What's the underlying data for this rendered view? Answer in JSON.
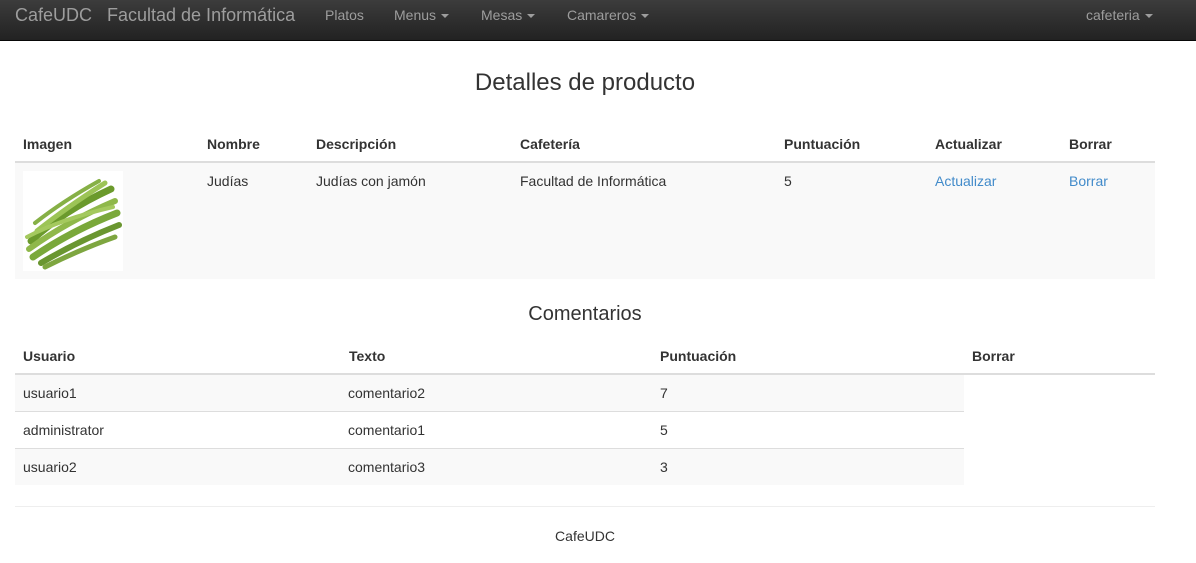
{
  "navbar": {
    "brand": "CafeUDC",
    "subtitle": "Facultad de Informática",
    "items": [
      {
        "label": "Platos",
        "dropdown": false
      },
      {
        "label": "Menus",
        "dropdown": true
      },
      {
        "label": "Mesas",
        "dropdown": true
      },
      {
        "label": "Camareros",
        "dropdown": true
      }
    ],
    "user_menu": "cafeteria"
  },
  "product": {
    "title": "Detalles de producto",
    "columns": [
      "Imagen",
      "Nombre",
      "Descripción",
      "Cafetería",
      "Puntuación",
      "Actualizar",
      "Borrar"
    ],
    "row": {
      "image_icon": "green-beans-photo",
      "nombre": "Judías",
      "descripcion": "Judías con jamón",
      "cafeteria": "Facultad de Informática",
      "puntuacion": "5",
      "actualizar": "Actualizar",
      "borrar": "Borrar"
    }
  },
  "comments": {
    "title": "Comentarios",
    "columns": [
      "Usuario",
      "Texto",
      "Puntuación",
      "Borrar"
    ],
    "rows": [
      {
        "usuario": "usuario1",
        "texto": "comentario2",
        "puntuacion": "7"
      },
      {
        "usuario": "administrator",
        "texto": "comentario1",
        "puntuacion": "5"
      },
      {
        "usuario": "usuario2",
        "texto": "comentario3",
        "puntuacion": "3"
      }
    ]
  },
  "footer": {
    "text": "CafeUDC"
  },
  "colors": {
    "navbar_bg": "#222222",
    "link": "#428bca",
    "stripe": "#f9f9f9",
    "text": "#333333"
  }
}
